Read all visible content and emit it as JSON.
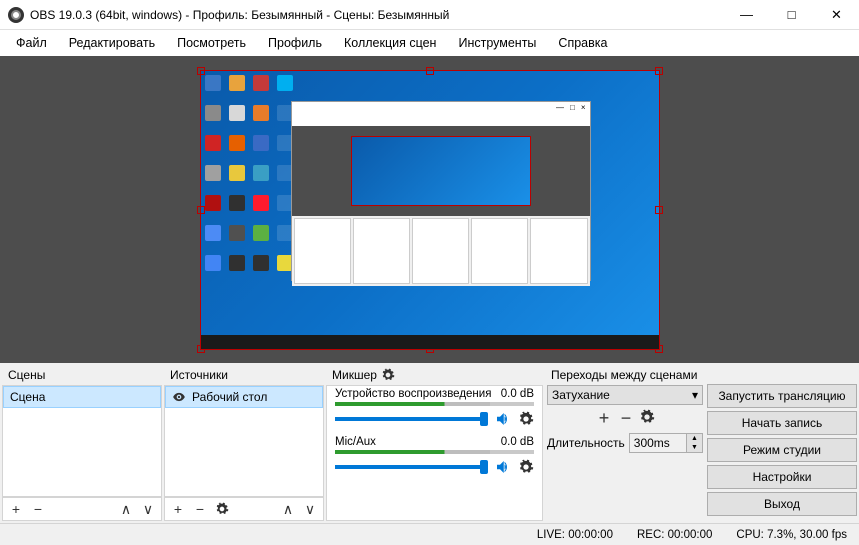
{
  "window": {
    "title": "OBS 19.0.3 (64bit, windows) - Профиль: Безымянный - Сцены: Безымянный"
  },
  "menu": {
    "file": "Файл",
    "edit": "Редактировать",
    "view": "Посмотреть",
    "profile": "Профиль",
    "scene_collection": "Коллекция сцен",
    "tools": "Инструменты",
    "help": "Справка"
  },
  "panels": {
    "scenes": {
      "title": "Сцены",
      "items": [
        "Сцена"
      ]
    },
    "sources": {
      "title": "Источники",
      "items": [
        {
          "label": "Рабочий стол",
          "visible": true
        }
      ]
    },
    "mixer": {
      "title": "Микшер",
      "channels": [
        {
          "name": "Устройство воспроизведения",
          "db": "0.0 dB"
        },
        {
          "name": "Mic/Aux",
          "db": "0.0 dB"
        }
      ]
    },
    "transitions": {
      "title": "Переходы между сценами",
      "selected": "Затухание",
      "duration_label": "Длительность",
      "duration_value": "300ms"
    },
    "buttons": {
      "start_stream": "Запустить трансляцию",
      "start_record": "Начать запись",
      "studio_mode": "Режим студии",
      "settings": "Настройки",
      "exit": "Выход"
    }
  },
  "status": {
    "live": "LIVE: 00:00:00",
    "rec": "REC: 00:00:00",
    "cpu": "CPU: 7.3%, 30.00 fps"
  }
}
